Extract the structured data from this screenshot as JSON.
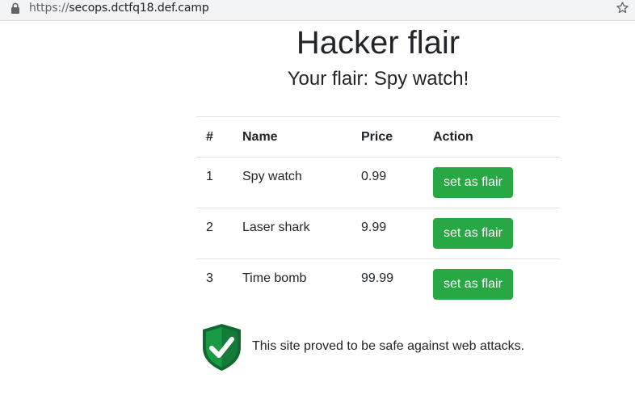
{
  "browser": {
    "url_scheme": "https://",
    "url_host": "secops.dctfq18.def.camp"
  },
  "page": {
    "title": "Hacker flair",
    "subtitle": "Your flair: Spy watch!"
  },
  "table": {
    "headers": [
      "#",
      "Name",
      "Price",
      "Action"
    ],
    "rows": [
      {
        "num": "1",
        "name": "Spy watch",
        "price": "0.99",
        "action": "set as flair"
      },
      {
        "num": "2",
        "name": "Laser shark",
        "price": "9.99",
        "action": "set as flair"
      },
      {
        "num": "3",
        "name": "Time bomb",
        "price": "99.99",
        "action": "set as flair"
      }
    ]
  },
  "badge": {
    "text": "This site proved to be safe against web attacks.",
    "icon": "shield-check-icon"
  },
  "colors": {
    "button": "#28a745",
    "shield_dark": "#0e6a2f",
    "shield_light": "#1b9a45"
  }
}
